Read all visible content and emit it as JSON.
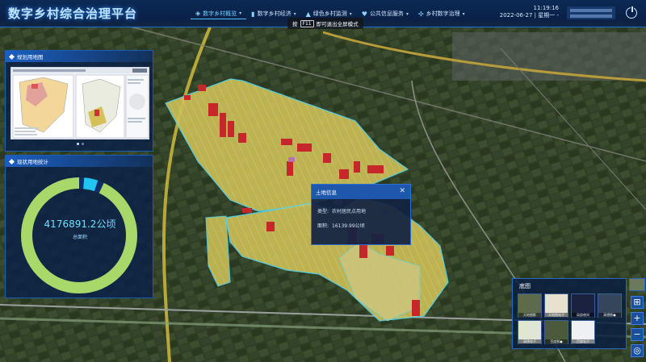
{
  "header": {
    "title": "数字乡村综合治理平台",
    "nav": [
      {
        "label": "数字乡村概览",
        "icon": "layers-icon",
        "active": true
      },
      {
        "label": "数字乡村经济",
        "icon": "bar-chart-icon",
        "active": false
      },
      {
        "label": "绿色乡村监测",
        "icon": "leaf-icon",
        "active": false
      },
      {
        "label": "公共信息服务",
        "icon": "heart-icon",
        "active": false
      },
      {
        "label": "乡村数字治理",
        "icon": "network-icon",
        "active": false
      }
    ],
    "time": "11:19:16",
    "date": "2022-06-27 | 星期一 -"
  },
  "f11_tip": {
    "prefix": "按",
    "key": "F11",
    "suffix": "即可退出全屏模式"
  },
  "plan_panel": {
    "title": "规划用地图"
  },
  "stats_panel": {
    "title": "现状用地统计",
    "total_value": "4176891.2公顷",
    "total_label": "总面积",
    "ring_fraction_main": 0.93
  },
  "popup": {
    "title": "土地信息",
    "rows": [
      {
        "label": "类型:",
        "value": "农村居民点用地"
      },
      {
        "label": "面积:",
        "value": "16139.99公顷"
      }
    ]
  },
  "basemap": {
    "title": "底图",
    "items": [
      {
        "label": "天地图影",
        "tone": "#5d6b4b"
      },
      {
        "label": "天地图电子",
        "tone": "#e8e1cf"
      },
      {
        "label": "局部夜间",
        "tone": "#1b2240"
      },
      {
        "label": "高德影●",
        "tone": "#35455c"
      },
      {
        "label": "高德电子",
        "tone": "#dfe6d4"
      },
      {
        "label": "百度影●",
        "tone": "#4b5a3c"
      },
      {
        "label": "百度电子",
        "tone": "#eef0f3"
      }
    ]
  },
  "tools": {
    "grid": "⊞",
    "plus": "+",
    "minus": "−",
    "locate": "◎"
  },
  "colors": {
    "accent": "#1d6fd6",
    "ring_main": "#a8d86a",
    "ring_secondary": "#22c4f4"
  }
}
